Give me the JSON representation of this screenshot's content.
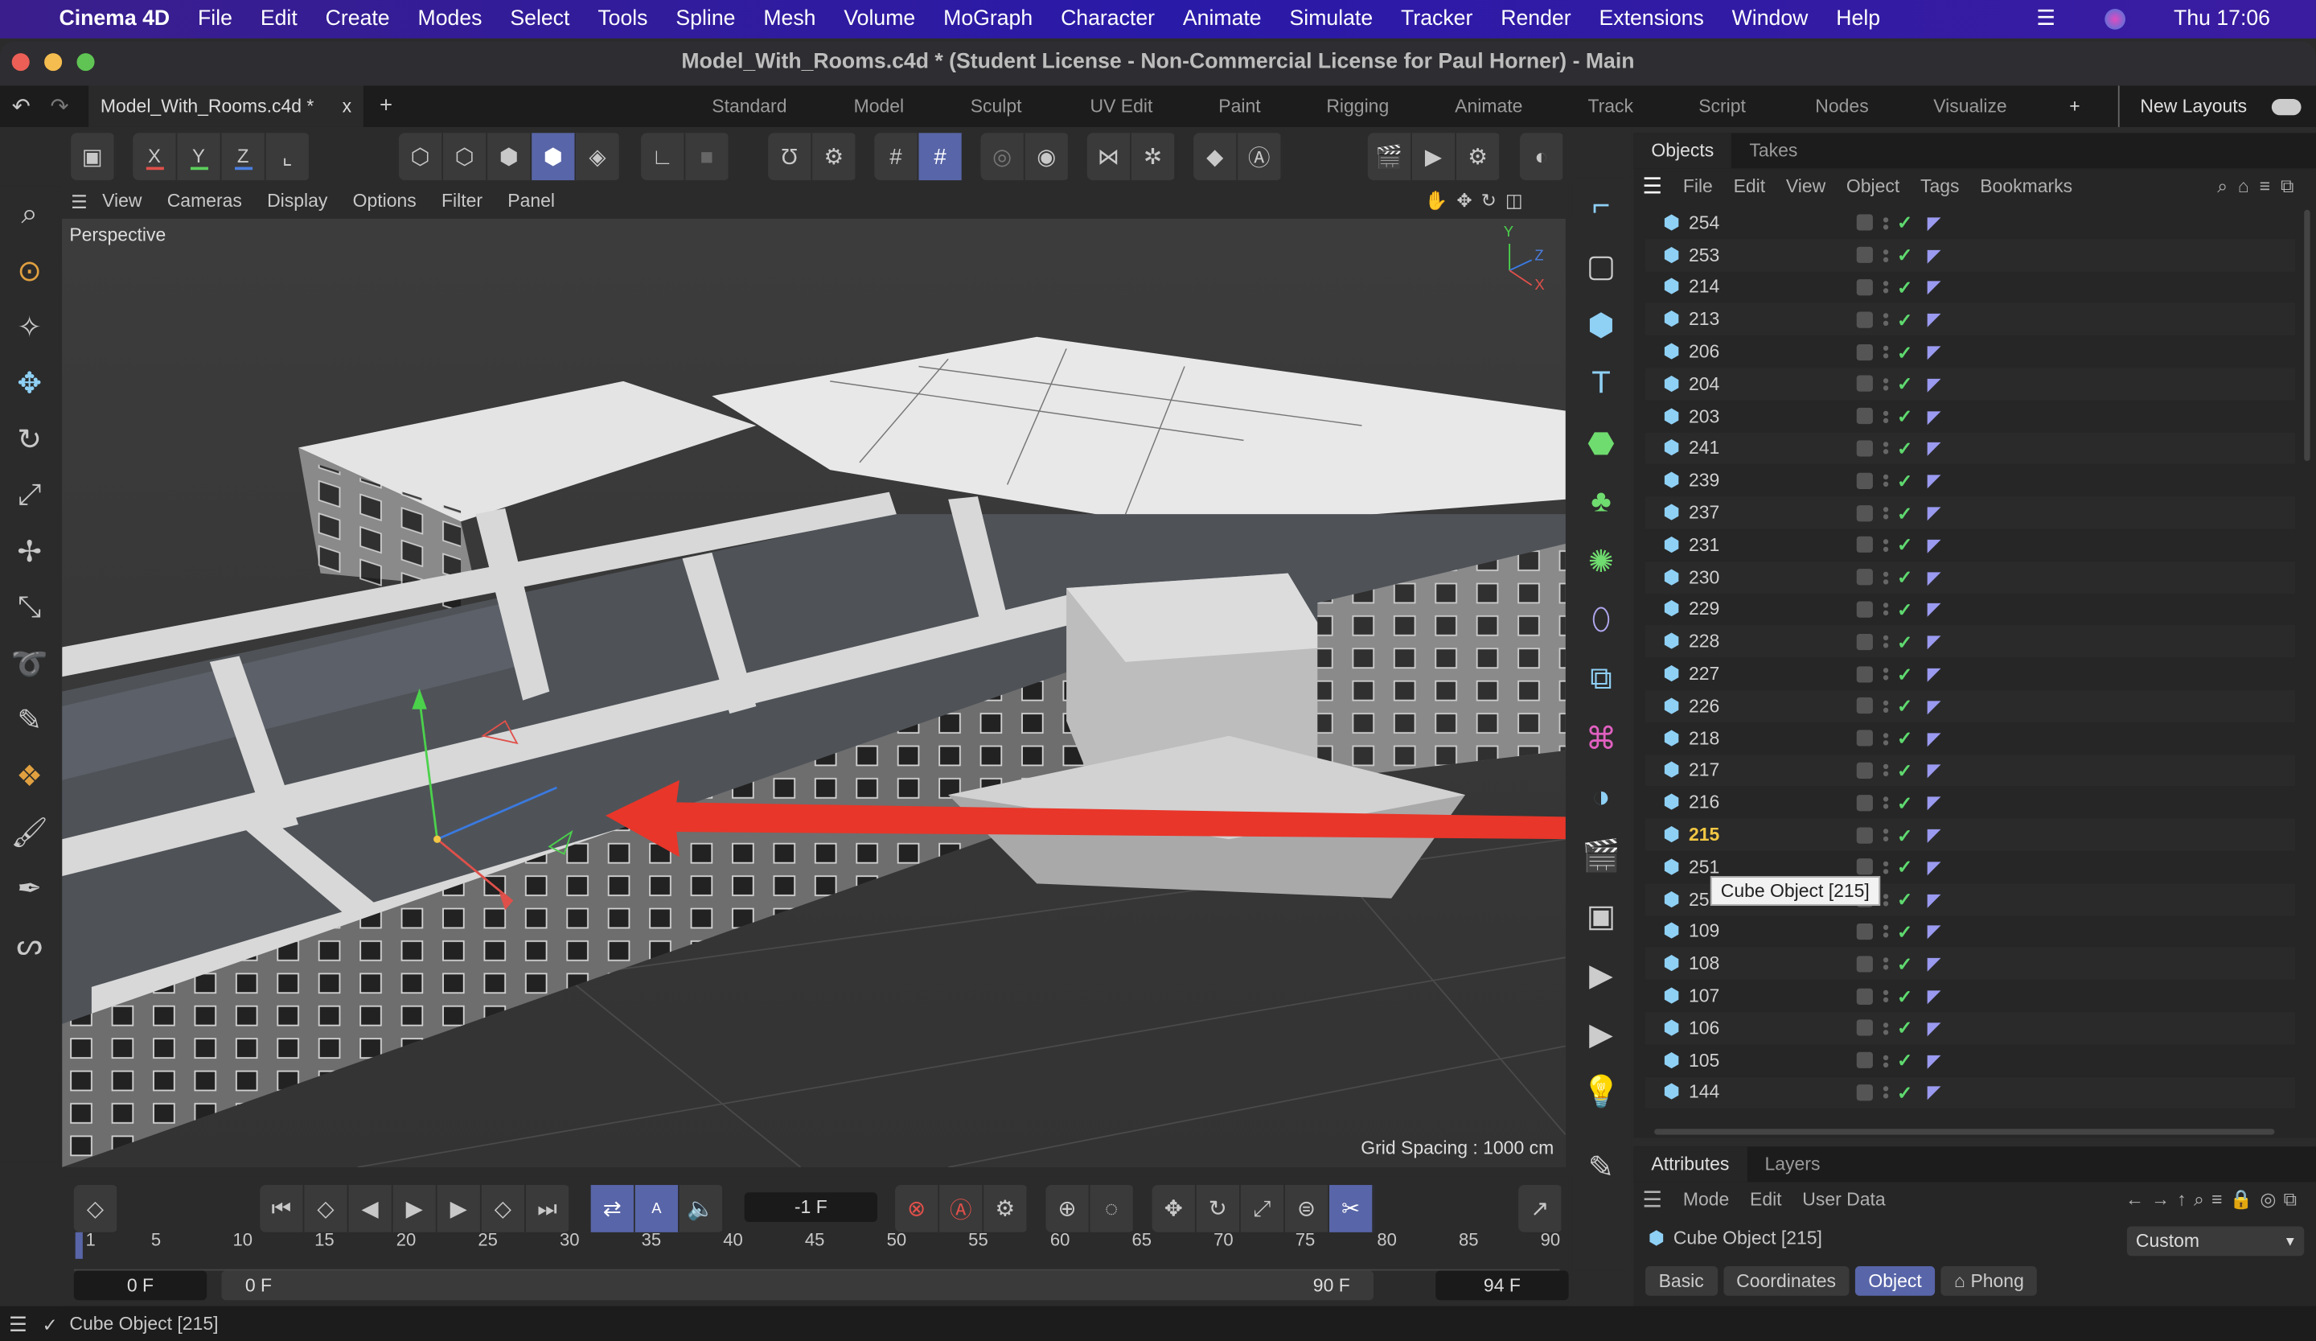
{
  "menubar": {
    "apple": "",
    "app": "Cinema 4D",
    "items": [
      "File",
      "Edit",
      "Create",
      "Modes",
      "Select",
      "Tools",
      "Spline",
      "Mesh",
      "Volume",
      "MoGraph",
      "Character",
      "Animate",
      "Simulate",
      "Tracker",
      "Render",
      "Extensions",
      "Window",
      "Help"
    ],
    "clock": "Thu  17:06"
  },
  "window": {
    "title": "Model_With_Rooms.c4d * (Student License - Non-Commercial License for Paul Horner) - Main"
  },
  "tabs": {
    "document": "Model_With_Rooms.c4d *",
    "close": "x",
    "add": "+",
    "layouts": [
      "Standard",
      "Model",
      "Sculpt",
      "UV Edit",
      "Paint",
      "Rigging",
      "Animate",
      "Track",
      "Script",
      "Nodes",
      "Visualize"
    ],
    "layout_add": "+",
    "new_layouts": "New Layouts"
  },
  "toolbar": {
    "axes": [
      "X",
      "Y",
      "Z"
    ],
    "axis_colors": [
      "#e0504a",
      "#5ccf5c",
      "#4a7ee0"
    ]
  },
  "viewport": {
    "menu": [
      "View",
      "Cameras",
      "Display",
      "Options",
      "Filter",
      "Panel"
    ],
    "camera": "Perspective",
    "grid_spacing": "Grid Spacing : 1000 cm",
    "axis_labels": {
      "y": "Y",
      "z": "Z",
      "x": "X"
    },
    "annotation_color": "#e8362a"
  },
  "objects": {
    "tabs": [
      "Objects",
      "Takes"
    ],
    "menu": [
      "File",
      "Edit",
      "View",
      "Object",
      "Tags",
      "Bookmarks"
    ],
    "items": [
      {
        "name": "254"
      },
      {
        "name": "253"
      },
      {
        "name": "214"
      },
      {
        "name": "213"
      },
      {
        "name": "206"
      },
      {
        "name": "204"
      },
      {
        "name": "203"
      },
      {
        "name": "241"
      },
      {
        "name": "239"
      },
      {
        "name": "237"
      },
      {
        "name": "231"
      },
      {
        "name": "230"
      },
      {
        "name": "229"
      },
      {
        "name": "228"
      },
      {
        "name": "227"
      },
      {
        "name": "226"
      },
      {
        "name": "218"
      },
      {
        "name": "217"
      },
      {
        "name": "216"
      },
      {
        "name": "215",
        "selected": true
      },
      {
        "name": "251"
      },
      {
        "name": "25"
      },
      {
        "name": "109"
      },
      {
        "name": "108"
      },
      {
        "name": "107"
      },
      {
        "name": "106"
      },
      {
        "name": "105"
      },
      {
        "name": "144"
      }
    ],
    "tooltip": "Cube Object [215]",
    "selected_color": "#f2c744"
  },
  "attributes": {
    "tabs": [
      "Attributes",
      "Layers"
    ],
    "menu": [
      "Mode",
      "Edit",
      "User Data"
    ],
    "object": "Cube Object [215]",
    "preset": "Custom",
    "subtabs": [
      "Basic",
      "Coordinates",
      "Object",
      "Phong"
    ],
    "active_subtab": "Object"
  },
  "timeline": {
    "current_frame": "-1 F",
    "ticks": [
      "1",
      "5",
      "10",
      "15",
      "20",
      "25",
      "30",
      "35",
      "40",
      "45",
      "50",
      "55",
      "60",
      "65",
      "70",
      "75",
      "80",
      "85",
      "90"
    ],
    "start": "0 F",
    "range_start": "0 F",
    "range_end": "90 F",
    "end": "94 F"
  },
  "status": {
    "text": "Cube Object [215]"
  }
}
